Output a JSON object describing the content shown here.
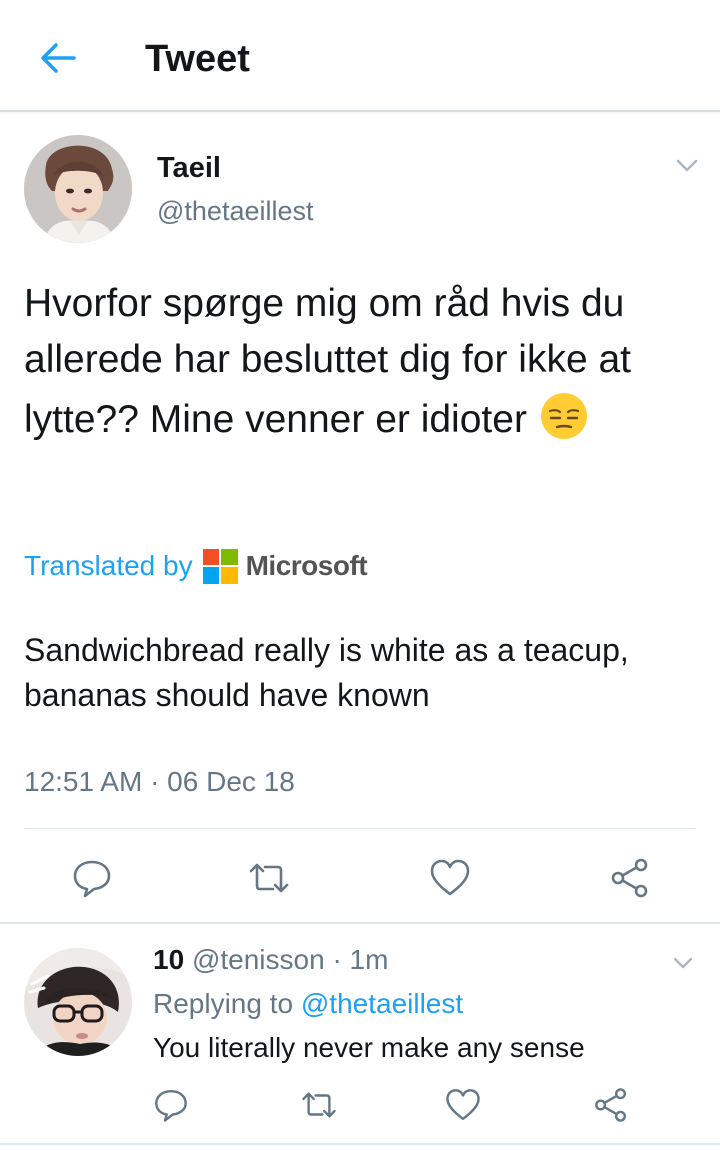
{
  "header": {
    "back_icon": "arrow-left-icon",
    "title": "Tweet",
    "accent_color": "#1da1f2"
  },
  "tweet": {
    "author_name": "Taeil",
    "author_handle": "@thetaeillest",
    "text": "Hvorfor spørge mig om råd hvis du allerede har besluttet dig for ikke at lytte?? Mine venner er idioter",
    "emoji": "pensive-face-emoji",
    "translated_by": "Translated by",
    "translator": "Microsoft",
    "translation": "Sandwichbread really is white as a teacup, bananas should have known",
    "timestamp": "12:51 AM · 06 Dec 18",
    "actions": [
      "reply-icon",
      "retweet-icon",
      "like-icon",
      "share-icon"
    ]
  },
  "reply": {
    "author_name": "10",
    "author_handle": "@tenisson",
    "time": "· 1m",
    "replying_prefix": "Replying to",
    "replying_to": "@thetaeillest",
    "text": "You literally never make any sense",
    "actions": [
      "reply-icon",
      "retweet-icon",
      "like-icon",
      "share-icon"
    ]
  },
  "colors": {
    "text": "#14171a",
    "secondary": "#657786",
    "link": "#1da1f2",
    "divider": "#e1e8ed"
  }
}
